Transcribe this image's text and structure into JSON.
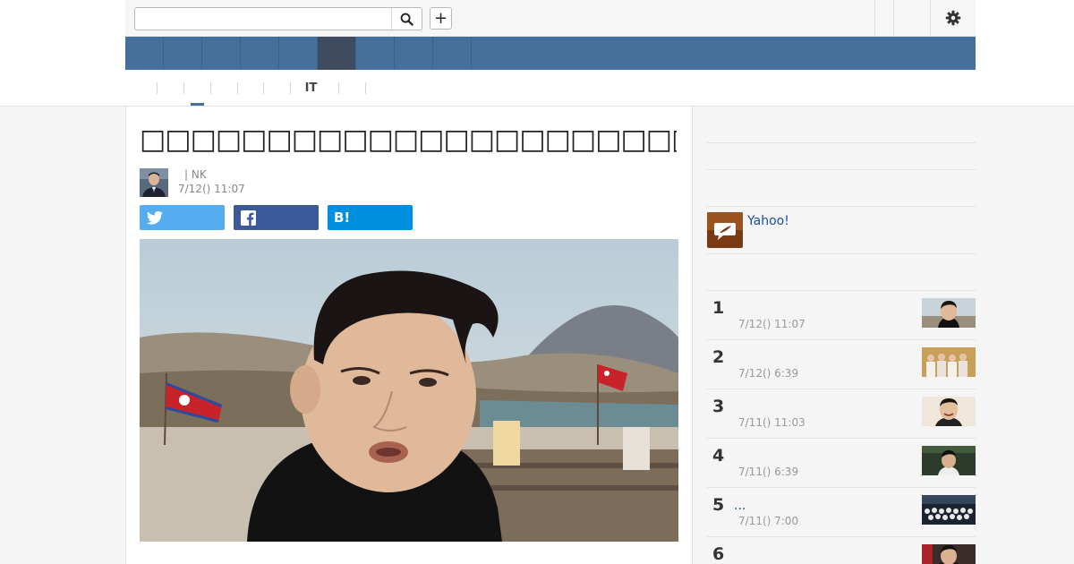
{
  "header": {
    "search_value": "",
    "search_icon": "search-icon",
    "add_label": "+",
    "settings_icon": "gear-icon"
  },
  "nav": {
    "items": [
      "",
      "",
      "",
      "",
      "",
      "",
      "",
      "",
      ""
    ],
    "active_index": 5
  },
  "subnav": {
    "items": [
      "",
      "",
      "",
      "",
      "",
      "IT",
      ""
    ],
    "active_index": 1
  },
  "article": {
    "title": "□□□□□□□□□□□□□□□□□□□□□□□□□□□□□□□□□□□□□□□□",
    "author_name": "| NK",
    "date": "7/12() 11:07",
    "share": {
      "twitter_icon": "twitter-icon",
      "twitter_label": "",
      "facebook_icon": "facebook-icon",
      "facebook_label": "",
      "hatena_label": "B!",
      "hatena_count": ""
    }
  },
  "sidebar": {
    "yahoo_link": "Yahoo!",
    "ranking": [
      {
        "rank": "1",
        "title": "",
        "date": "7/12() 11:07"
      },
      {
        "rank": "2",
        "title": "",
        "date": "7/12() 6:39"
      },
      {
        "rank": "3",
        "title": "",
        "date": "7/11() 11:03"
      },
      {
        "rank": "4",
        "title": "",
        "date": "7/11() 6:39"
      },
      {
        "rank": "5",
        "title": "...",
        "date": "7/11() 7:00"
      },
      {
        "rank": "6",
        "title": "",
        "date": ""
      }
    ]
  },
  "colors": {
    "nav_blue": "#46709c",
    "nav_active": "#3f4b5f",
    "twitter": "#55acee",
    "facebook": "#3b5998",
    "hatena": "#008fde",
    "link": "#1a4e9a"
  }
}
